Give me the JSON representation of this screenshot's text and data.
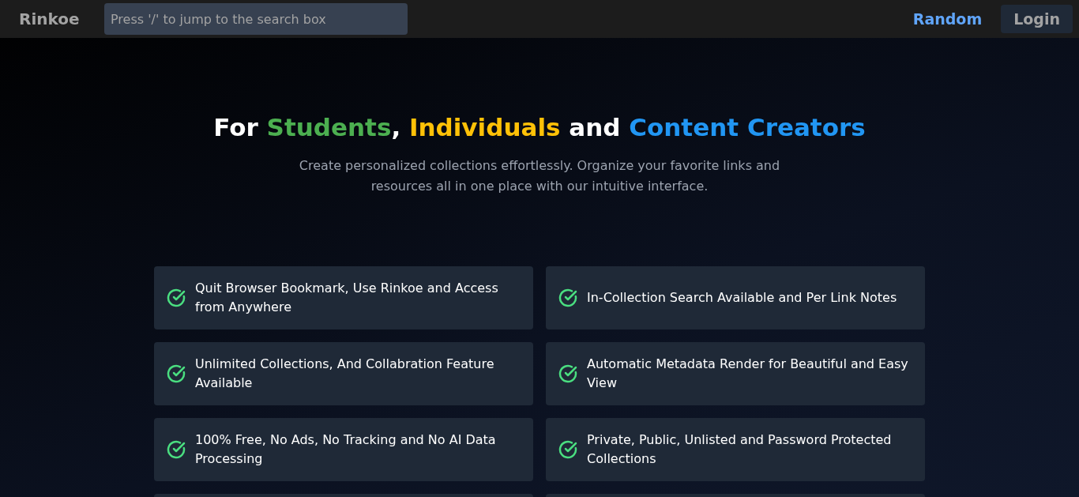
{
  "navbar": {
    "logo": "Rinkoe",
    "search": {
      "placeholder": "Press '/' to jump to the search box"
    },
    "random_link": "Random",
    "login_button": "Login"
  },
  "hero": {
    "title": [
      {
        "text": "For ",
        "color": "#ffffff"
      },
      {
        "text": "Students",
        "color": "#4caf50"
      },
      {
        "text": ", ",
        "color": "#ffffff"
      },
      {
        "text": "Individuals",
        "color": "#ffc107"
      },
      {
        "text": " and ",
        "color": "#ffffff"
      },
      {
        "text": "Content Creators",
        "color": "#2196f3"
      }
    ],
    "subtitle": "Create personalized collections effortlessly. Organize your favorite links and resources all in one place with our intuitive interface."
  },
  "features": [
    {
      "text": "Quit Browser Bookmark, Use Rinkoe and Access from Anywhere"
    },
    {
      "text": "In-Collection Search Available and Per Link Notes"
    },
    {
      "text": "Unlimited Collections, And Collabration Feature Available"
    },
    {
      "text": "Automatic Metadata Render for Beautiful and Easy View"
    },
    {
      "text": "100% Free, No Ads, No Tracking and No AI Data Processing"
    },
    {
      "text": "Private, Public, Unlisted and Password Protected Collections"
    }
  ]
}
